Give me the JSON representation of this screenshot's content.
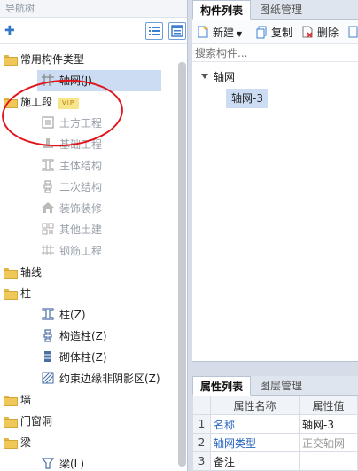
{
  "nav": {
    "title": "导航树",
    "tree": [
      {
        "id": "common",
        "label": "常用构件类型",
        "kind": "folder"
      },
      {
        "id": "axis-net",
        "label": "轴网(J)",
        "kind": "item",
        "icon": "grid-icon",
        "selected": true
      },
      {
        "id": "construction",
        "label": "施工段",
        "kind": "folder",
        "badge": "VIP"
      },
      {
        "id": "earthwork",
        "label": "土方工程",
        "kind": "item",
        "icon": "earthwork-icon",
        "disabled": true
      },
      {
        "id": "foundation",
        "label": "基础工程",
        "kind": "item",
        "icon": "foundation-icon",
        "disabled": true
      },
      {
        "id": "main-structure",
        "label": "主体结构",
        "kind": "item",
        "icon": "column-icon",
        "disabled": true
      },
      {
        "id": "secondary",
        "label": "二次结构",
        "kind": "item",
        "icon": "secondary-icon",
        "disabled": true
      },
      {
        "id": "decoration",
        "label": "装饰装修",
        "kind": "item",
        "icon": "house-icon",
        "disabled": true
      },
      {
        "id": "other-civil",
        "label": "其他土建",
        "kind": "item",
        "icon": "other-icon",
        "disabled": true
      },
      {
        "id": "rebar",
        "label": "钢筋工程",
        "kind": "item",
        "icon": "rebar-icon",
        "disabled": true
      },
      {
        "id": "axis-line",
        "label": "轴线",
        "kind": "folder"
      },
      {
        "id": "column",
        "label": "柱",
        "kind": "folder"
      },
      {
        "id": "column-z",
        "label": "柱(Z)",
        "kind": "item",
        "icon": "column-icon"
      },
      {
        "id": "construct-col",
        "label": "构造柱(Z)",
        "kind": "item",
        "icon": "construct-column-icon"
      },
      {
        "id": "masonry-col",
        "label": "砌体柱(Z)",
        "kind": "item",
        "icon": "masonry-column-icon"
      },
      {
        "id": "constraint",
        "label": "约束边缘非阴影区(Z)",
        "kind": "item",
        "icon": "hatch-icon"
      },
      {
        "id": "wall",
        "label": "墙",
        "kind": "folder"
      },
      {
        "id": "door-window",
        "label": "门窗洞",
        "kind": "folder"
      },
      {
        "id": "beam",
        "label": "梁",
        "kind": "folder"
      },
      {
        "id": "beam-l",
        "label": "梁(L)",
        "kind": "item",
        "icon": "beam-icon"
      }
    ]
  },
  "component_panel": {
    "tabs": [
      {
        "label": "构件列表",
        "active": true
      },
      {
        "label": "图纸管理",
        "active": false
      }
    ],
    "toolbar": {
      "new_label": "新建",
      "copy_label": "复制",
      "delete_label": "删除"
    },
    "search_placeholder": "搜索构件...",
    "tree_root": "轴网",
    "tree_child": "轴网-3"
  },
  "property_panel": {
    "tabs": [
      {
        "label": "属性列表",
        "active": true
      },
      {
        "label": "图层管理",
        "active": false
      }
    ],
    "headers": {
      "name": "属性名称",
      "value": "属性值"
    },
    "rows": [
      {
        "num": "1",
        "name": "名称",
        "value": "轴网-3",
        "name_link": true,
        "value_gray": false
      },
      {
        "num": "2",
        "name": "轴网类型",
        "value": "正交轴网",
        "name_link": true,
        "value_gray": true
      },
      {
        "num": "3",
        "name": "备注",
        "value": "",
        "name_link": false,
        "value_gray": false
      }
    ]
  },
  "colors": {
    "selected_bg": "#cbdcf3",
    "annotation_circle": "#e2141a",
    "link": "#2a66c0",
    "vip_bg": "#f8e58a"
  }
}
